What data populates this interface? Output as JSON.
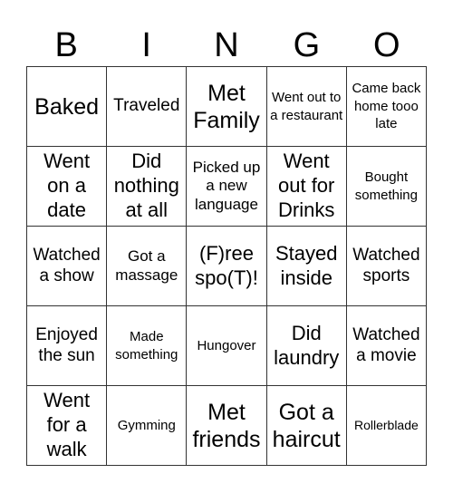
{
  "header": {
    "letters": [
      "B",
      "I",
      "N",
      "G",
      "O"
    ]
  },
  "grid": {
    "rows": [
      [
        "Baked",
        "Traveled",
        "Met Family",
        "Went out to a restaurant",
        "Came back home tooo late"
      ],
      [
        "Went on a date",
        "Did nothing at all",
        "Picked up a new language",
        "Went out for Drinks",
        "Bought something"
      ],
      [
        "Watched a show",
        "Got a massage",
        "(F)ree spo(T)!",
        "Stayed inside",
        "Watched sports"
      ],
      [
        "Enjoyed the sun",
        "Made something",
        "Hungover",
        "Did laundry",
        "Watched a movie"
      ],
      [
        "Went for a walk",
        "Gymming",
        "Met friends",
        "Got a haircut",
        "Rollerblade"
      ]
    ],
    "free_space": "(F)ree spo(T)!"
  }
}
